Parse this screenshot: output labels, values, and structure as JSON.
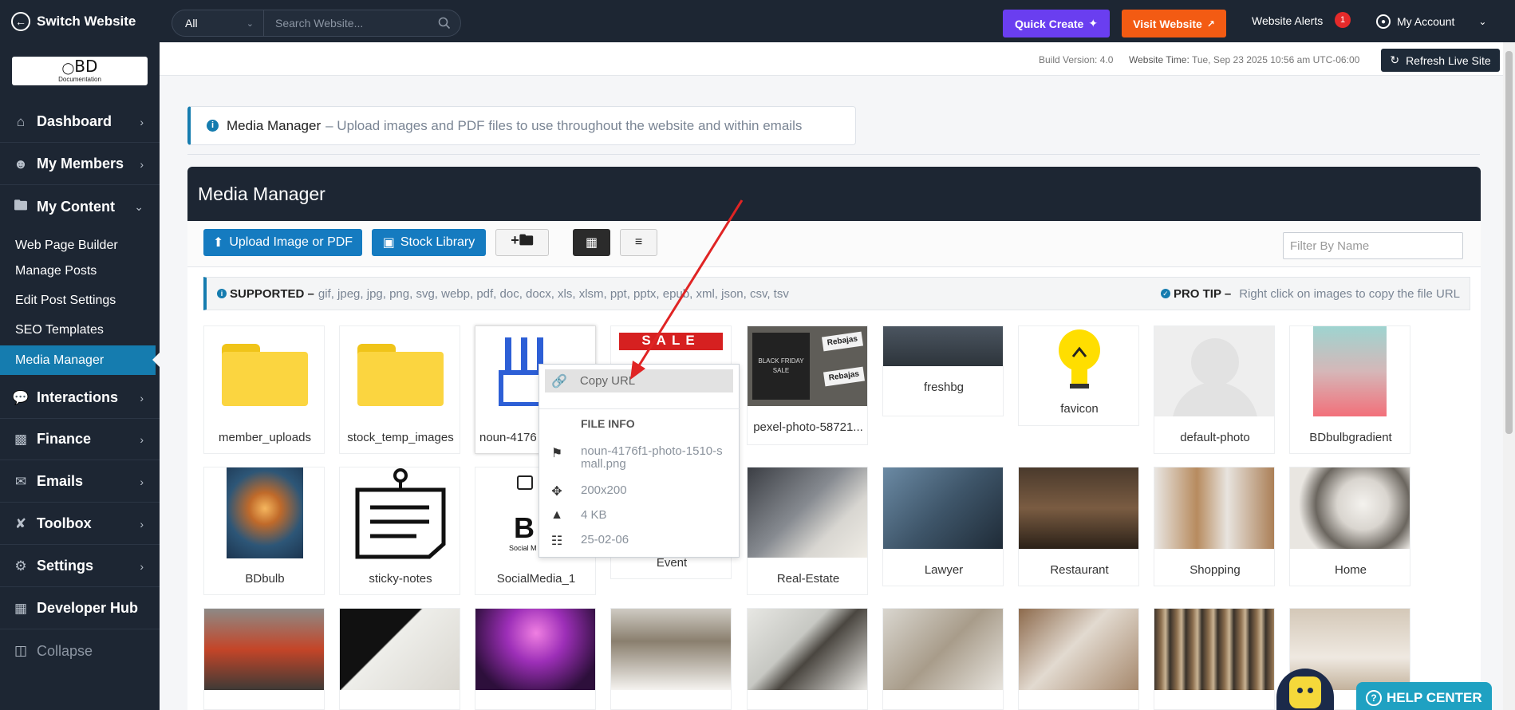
{
  "topbar": {
    "switch_label": "Switch Website",
    "search_scope": "All",
    "search_placeholder": "Search Website...",
    "quick_create": "Quick Create",
    "visit_website": "Visit Website",
    "website_alerts": "Website Alerts",
    "alerts_count": "1",
    "my_account": "My Account"
  },
  "sidebar": {
    "logo_text": "BD",
    "logo_sub": "Documentation",
    "items": [
      {
        "label": "Dashboard"
      },
      {
        "label": "My Members"
      },
      {
        "label": "My Content"
      },
      {
        "label": "Interactions"
      },
      {
        "label": "Finance"
      },
      {
        "label": "Emails"
      },
      {
        "label": "Toolbox"
      },
      {
        "label": "Settings"
      },
      {
        "label": "Developer Hub"
      },
      {
        "label": "Collapse"
      }
    ],
    "subitems": [
      {
        "label": "Web Page Builder"
      },
      {
        "label": "Manage Posts"
      },
      {
        "label": "Edit Post Settings"
      },
      {
        "label": "SEO Templates"
      },
      {
        "label": "Media Manager"
      }
    ]
  },
  "infobar": {
    "build_version": "Build Version: 4.0",
    "website_time_label": "Website Time:",
    "website_time_value": "Tue, Sep 23 2025 10:56 am UTC-06:00",
    "refresh_label": "Refresh Live Site"
  },
  "notice": {
    "title": "Media Manager",
    "text": "– Upload images and PDF files to use throughout the website and within emails"
  },
  "panel": {
    "title": "Media Manager",
    "upload_label": "Upload Image or PDF",
    "stock_label": "Stock Library",
    "filter_placeholder": "Filter By Name",
    "supported_label": "SUPPORTED –",
    "supported_types": "gif, jpeg, jpg, png, svg, webp, pdf, doc, docx, xls, xlsm, ppt, pptx, epub, xml, json, csv, tsv",
    "protip_label": "PRO TIP –",
    "protip_text": "Right click on images to copy the file URL"
  },
  "tiles": [
    {
      "caption": "member_uploads"
    },
    {
      "caption": "stock_temp_images"
    },
    {
      "caption": "noun-4176"
    },
    {
      "caption": ""
    },
    {
      "caption": "pexel-photo-58721..."
    },
    {
      "caption": "freshbg"
    },
    {
      "caption": "favicon"
    },
    {
      "caption": "default-photo"
    },
    {
      "caption": "BDbulbgradient"
    },
    {
      "caption": "BDbulb"
    },
    {
      "caption": "sticky-notes"
    },
    {
      "caption": "SocialMedia_1"
    },
    {
      "caption": "Event"
    },
    {
      "caption": "Real-Estate"
    },
    {
      "caption": "Lawyer"
    },
    {
      "caption": "Restaurant"
    },
    {
      "caption": "Shopping"
    },
    {
      "caption": "Home"
    }
  ],
  "thumb_texts": {
    "sale": "SALE",
    "black_friday": "BLACK FRIDAY SALE",
    "rebajas": "Rebajas",
    "social_letter": "B",
    "social_sub": "Social M"
  },
  "context_menu": {
    "copy_url": "Copy URL",
    "file_info": "FILE INFO",
    "filename": "noun-4176f1-photo-1510-small.png",
    "dimensions": "200x200",
    "size": "4 KB",
    "date": "25-02-06"
  },
  "help_center": "HELP CENTER"
}
